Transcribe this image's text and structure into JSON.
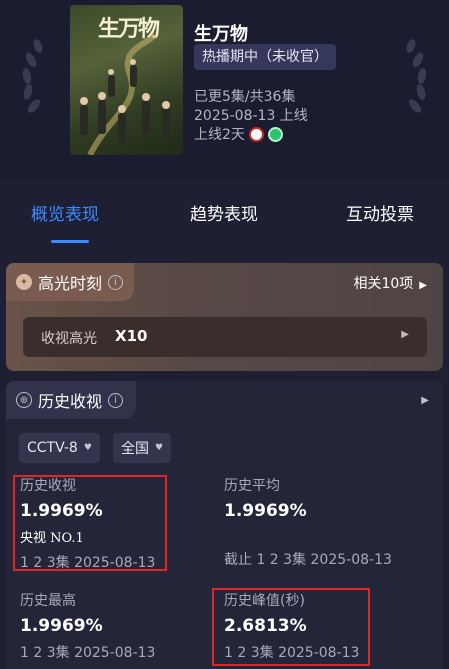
{
  "show": {
    "title": "生万物",
    "status": "热播期中（未收官）",
    "updated": "已更5集/共36集",
    "air_date": "2025-08-13 上线",
    "online_days": "上线2天",
    "poster_glyph": "生万物"
  },
  "tabs": [
    "概览表现",
    "趋势表现",
    "互动投票"
  ],
  "highlight": {
    "title": "高光时刻",
    "related": "相关10项",
    "row_label": "收视高光",
    "row_value": "X10"
  },
  "history": {
    "title": "历史收视",
    "channel": "CCTV-8",
    "region": "全国",
    "stats": [
      {
        "label": "历史收视",
        "value": "1.9969%",
        "extra": "央视 NO.1",
        "date": "1 2 3集 2025-08-13"
      },
      {
        "label": "历史平均",
        "value": "1.9969%",
        "extra": "",
        "date": "截止 1 2 3集 2025-08-13"
      },
      {
        "label": "历史最高",
        "value": "1.9969%",
        "extra": "",
        "date": "1 2 3集 2025-08-13"
      },
      {
        "label": "历史峰值(秒)",
        "value": "2.6813%",
        "extra": "",
        "date": "1 2 3集 2025-08-13"
      }
    ]
  },
  "colors": {
    "accent": "#3d8bff",
    "highlight_box": "#e02626"
  },
  "icons": {
    "cctv_platform": "cctv-logo-icon",
    "second_platform": "green-platform-icon"
  }
}
